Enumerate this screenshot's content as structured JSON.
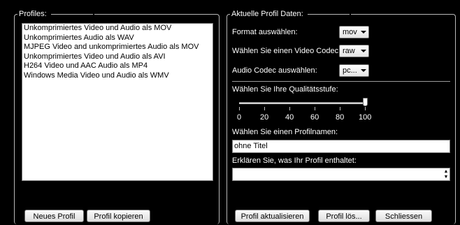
{
  "profiles": {
    "title": "Profiles:",
    "items": [
      "Unkomprimiertes Video und Audio als MOV",
      "Unkomprimiertes Audio als WAV",
      "MJPEG Video and unkomprimiertes Audio als MOV",
      "Unkomprimiertes Video und Audio als AVI",
      "H264 Video und AAC Audio als MP4",
      "Windows Media Video und Audio als WMV"
    ],
    "new_button": "Neues Profil",
    "copy_button": "Profil kopieren"
  },
  "current": {
    "title": "Aktuelle Profil Daten:",
    "format_label": "Format auswählen:",
    "format_value": "mov",
    "video_codec_label": "Wählen Sie einen Video Codec:",
    "video_codec_value": "raw",
    "audio_codec_label": "Audio Codec auswählen:",
    "audio_codec_value": "pc...",
    "quality_label": "Wählen Sie Ihre Qualitätsstufe:",
    "quality_ticks": [
      "0",
      "20",
      "40",
      "60",
      "80",
      "100"
    ],
    "quality_value": 100,
    "profile_name_label": "Wählen Sie einen Profilnamen:",
    "profile_name_value": "ohne Titel",
    "description_label": "Erklären Sie, was Ihr Profil enthaltet:",
    "description_value": "",
    "update_button": "Profil aktualisieren",
    "delete_button": "Profil lös...",
    "close_button": "Schliessen"
  }
}
